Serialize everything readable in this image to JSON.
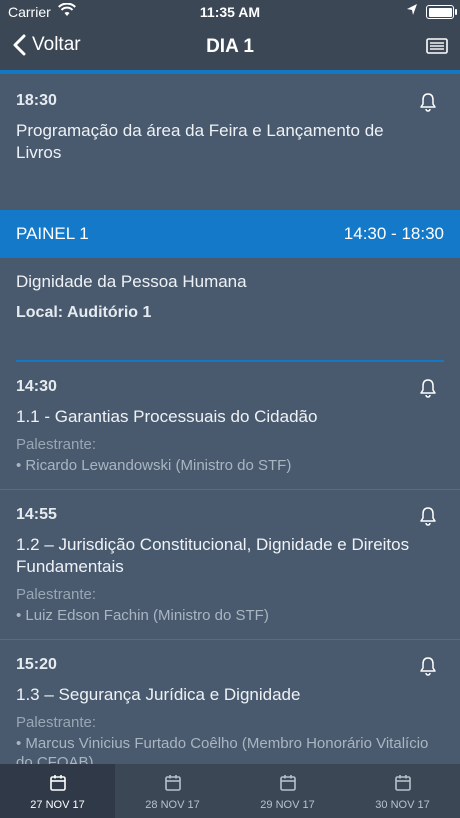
{
  "status": {
    "carrier": "Carrier",
    "time": "11:35 AM"
  },
  "nav": {
    "back_label": "Voltar",
    "title": "DIA 1"
  },
  "sessions": [
    {
      "time": "18:30",
      "title": "Programação da área da Feira e Lançamento de Livros"
    }
  ],
  "panel": {
    "label": "PAINEL 1",
    "time_range": "14:30 - 18:30",
    "name": "Dignidade da Pessoa Humana",
    "local": "Local: Auditório 1"
  },
  "talks": [
    {
      "time": "14:30",
      "title": "1.1 - Garantias Processuais do Cidadão",
      "speaker_label": "Palestrante:",
      "speaker": "• Ricardo Lewandowski (Ministro do STF)"
    },
    {
      "time": "14:55",
      "title": "1.2 – Jurisdição Constitucional, Dignidade e Direitos Fundamentais",
      "speaker_label": "Palestrante:",
      "speaker": "• Luiz Edson Fachin (Ministro do STF)"
    },
    {
      "time": "15:20",
      "title": "1.3 – Segurança Jurídica e Dignidade",
      "speaker_label": "Palestrante:",
      "speaker": "• Marcus Vinicius Furtado Coêlho (Membro Honorário Vitalício do CFOAB)"
    }
  ],
  "tabs": [
    {
      "label": "27 NOV 17",
      "icon": "calendar-icon",
      "active": true
    },
    {
      "label": "28 NOV 17",
      "icon": "calendar-icon",
      "active": false
    },
    {
      "label": "29 NOV 17",
      "icon": "calendar-icon",
      "active": false
    },
    {
      "label": "30 NOV 17",
      "icon": "calendar-icon",
      "active": false
    }
  ],
  "colors": {
    "background": "#4a5a6e",
    "bar": "#3c4756",
    "accent": "#1479c8"
  }
}
